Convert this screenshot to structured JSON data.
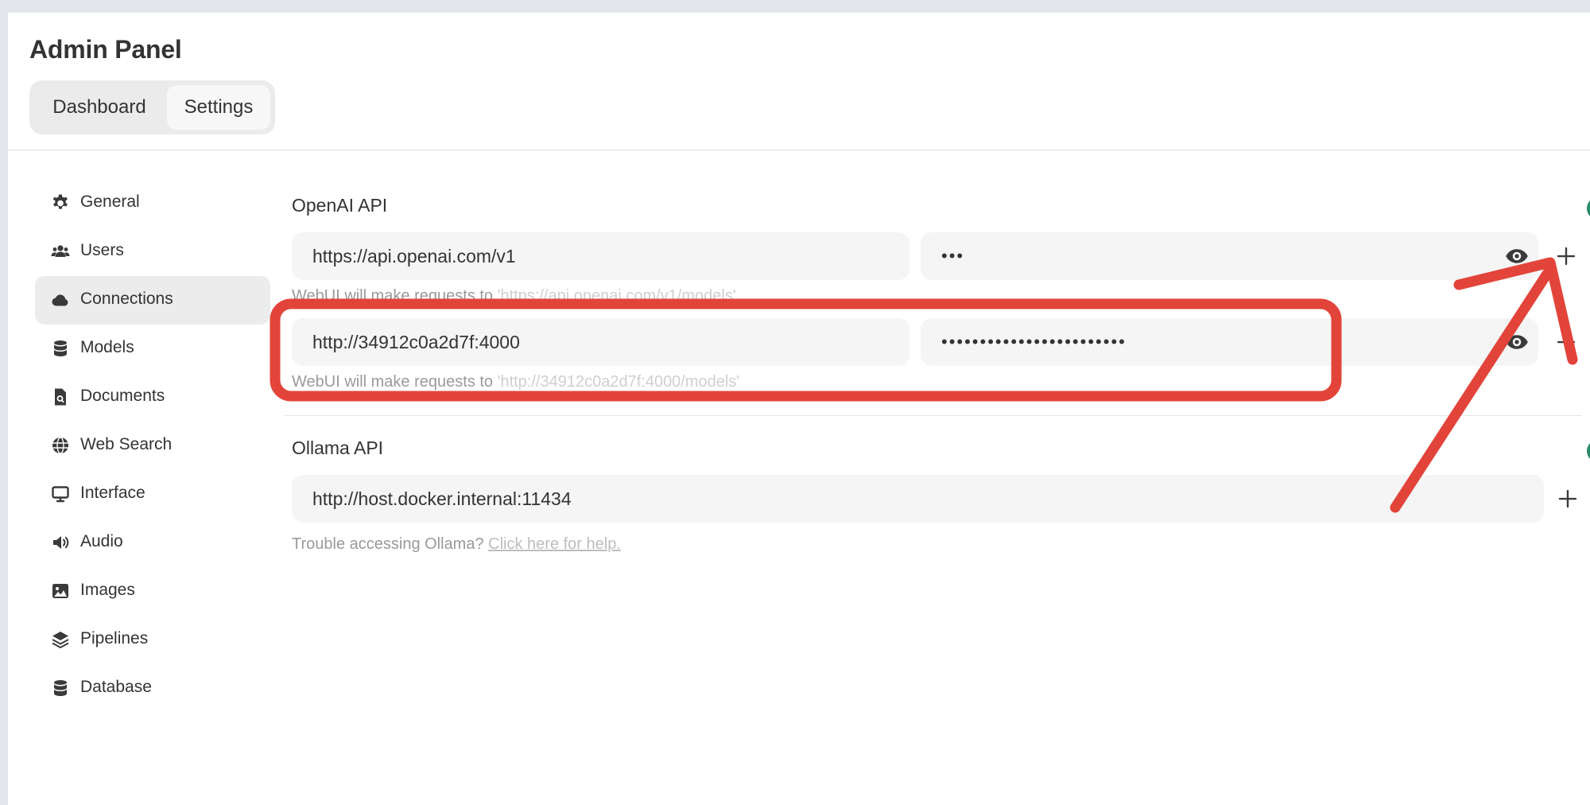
{
  "page": {
    "title": "Admin Panel"
  },
  "tabs": [
    {
      "label": "Dashboard",
      "active": false
    },
    {
      "label": "Settings",
      "active": true
    }
  ],
  "sidebar": {
    "items": [
      {
        "label": "General",
        "icon": "gear-icon",
        "active": false
      },
      {
        "label": "Users",
        "icon": "users-icon",
        "active": false
      },
      {
        "label": "Connections",
        "icon": "cloud-icon",
        "active": true
      },
      {
        "label": "Models",
        "icon": "database-icon",
        "active": false
      },
      {
        "label": "Documents",
        "icon": "document-search-icon",
        "active": false
      },
      {
        "label": "Web Search",
        "icon": "globe-icon",
        "active": false
      },
      {
        "label": "Interface",
        "icon": "monitor-icon",
        "active": false
      },
      {
        "label": "Audio",
        "icon": "speaker-icon",
        "active": false
      },
      {
        "label": "Images",
        "icon": "image-icon",
        "active": false
      },
      {
        "label": "Pipelines",
        "icon": "layers-icon",
        "active": false
      },
      {
        "label": "Database",
        "icon": "database-icon",
        "active": false
      }
    ]
  },
  "openai": {
    "title": "OpenAI API",
    "connections": [
      {
        "url": "https://api.openai.com/v1",
        "key_masked": "•••",
        "hint_prefix": "WebUI will make requests to ",
        "hint_url": "'https://api.openai.com/v1/models'"
      },
      {
        "url": "http://34912c0a2d7f:4000",
        "key_masked": "••••••••••••••••••••••••",
        "hint_prefix": "WebUI will make requests to ",
        "hint_url": "'http://34912c0a2d7f:4000/models'"
      }
    ]
  },
  "ollama": {
    "title": "Ollama API",
    "url": "http://host.docker.internal:11434",
    "help_prefix": "Trouble accessing Ollama?",
    "help_link": "Click here for help."
  },
  "colors": {
    "annotation": "#e2443a",
    "active_nav": "#ececec",
    "field_bg": "#f5f5f5",
    "toggle_accent": "#2a8a69"
  }
}
